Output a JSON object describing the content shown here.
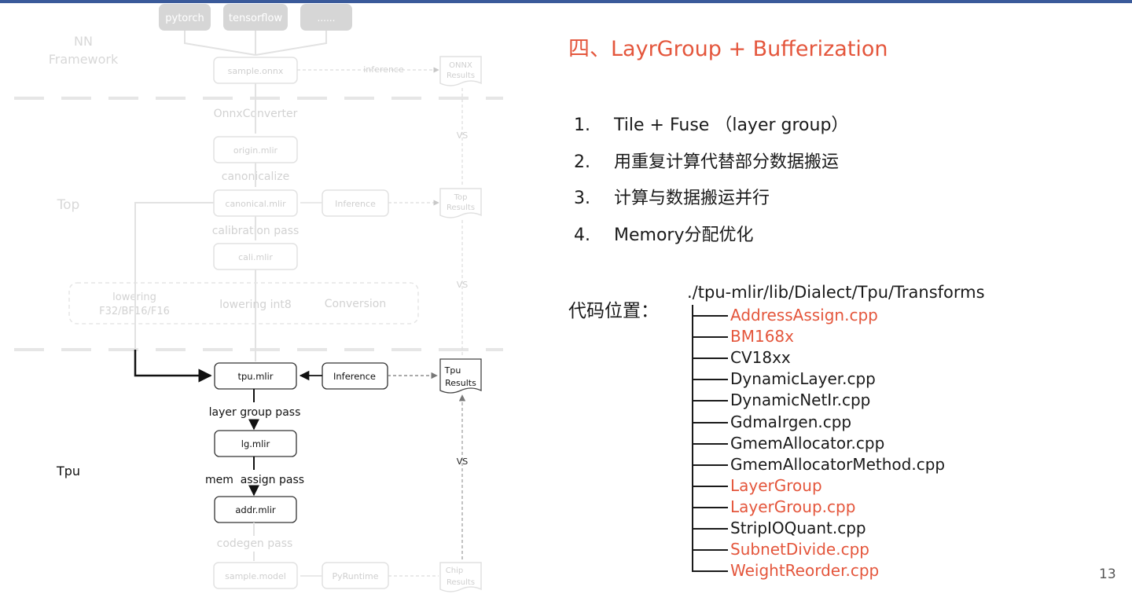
{
  "slide": {
    "title": "四、LayrGroup + Bufferization",
    "page_number": "13",
    "accent_color": "#e4563c"
  },
  "points": [
    {
      "num": "1.",
      "text": "Tile + Fuse （layer group）"
    },
    {
      "num": "2.",
      "text": "用重复计算代替部分数据搬运"
    },
    {
      "num": "3.",
      "text": "计算与数据搬运并行"
    },
    {
      "num": "4.",
      "text": "Memory分配优化"
    }
  ],
  "code_location": {
    "label": "代码位置：",
    "root": "./tpu-mlir/lib/Dialect/Tpu/Transforms",
    "items": [
      {
        "name": "AddressAssign.cpp",
        "highlight": true
      },
      {
        "name": "BM168x",
        "highlight": true
      },
      {
        "name": "CV18xx",
        "highlight": false
      },
      {
        "name": "DynamicLayer.cpp",
        "highlight": false
      },
      {
        "name": "DynamicNetIr.cpp",
        "highlight": false
      },
      {
        "name": "GdmaIrgen.cpp",
        "highlight": false
      },
      {
        "name": "GmemAllocator.cpp",
        "highlight": false
      },
      {
        "name": "GmemAllocatorMethod.cpp",
        "highlight": false
      },
      {
        "name": "LayerGroup",
        "highlight": true
      },
      {
        "name": "LayerGroup.cpp",
        "highlight": true
      },
      {
        "name": "StripIOQuant.cpp",
        "highlight": false
      },
      {
        "name": "SubnetDivide.cpp",
        "highlight": true
      },
      {
        "name": "WeightReorder.cpp",
        "highlight": true
      }
    ]
  },
  "diagram": {
    "section_labels": {
      "framework": "NN\nFramework",
      "top": "Top",
      "tpu": "Tpu"
    },
    "frameworks": [
      "pytorch",
      "tensorflow",
      "......"
    ],
    "nodes": {
      "onnx": "sample.onnx",
      "origin": "origin.mlir",
      "canonical": "canonical.mlir",
      "cali": "cali.mlir",
      "tpu": "tpu.mlir",
      "lg": "lg.mlir",
      "addr": "addr.mlir",
      "model": "sample.model",
      "inference_top": "Inference",
      "inference_tpu": "Inference",
      "pyruntime": "PyRuntime"
    },
    "results": {
      "onnx": "ONNX\nResults",
      "top": "Top\nResults",
      "tpu": "Tpu\nResults",
      "chip": "Chip\nResults"
    },
    "edges": {
      "inference": "inference",
      "onnx_converter": "OnnxConverter",
      "canonicalize": "canonicalize",
      "calibration": "calibration pass",
      "layer_group": "layer group pass",
      "mem_assign": "mem  assign pass",
      "codegen": "codegen pass",
      "vs": "VS"
    },
    "lowering": {
      "f_types": "lowering\nF32/BF16/F16",
      "int8": "lowering int8",
      "conversion": "Conversion"
    }
  }
}
